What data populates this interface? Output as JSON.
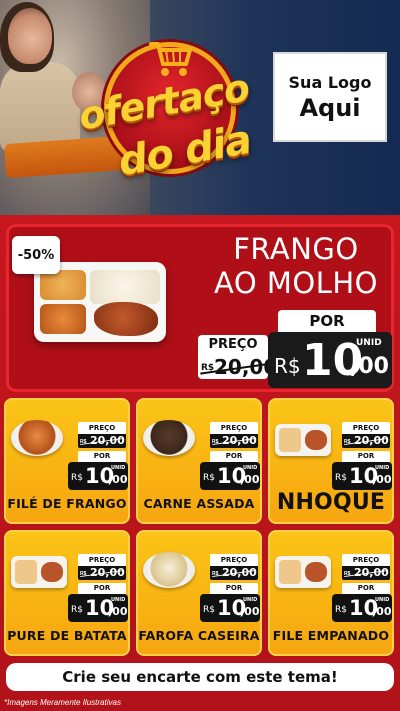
{
  "brand": {
    "badge_line1": "ofertaço",
    "badge_line2": "do dia",
    "colors": {
      "red": "#b3121a",
      "yellow": "#fbc417",
      "gold": "#fcd232",
      "dark": "#111111"
    }
  },
  "logo": {
    "line1": "Sua Logo",
    "line2": "Aqui"
  },
  "featured": {
    "discount": "-50%",
    "name_line1": "FRANGO",
    "name_line2": "AO MOLHO",
    "price_label": "PREÇO",
    "old_currency": "R$",
    "old_price": "20,00",
    "por_label": "POR",
    "new_currency": "R$",
    "new_main": "10",
    "new_cents": ",00",
    "unit": "UNID"
  },
  "products": [
    {
      "name": "FILÉ DE FRANGO",
      "price_label": "PREÇO",
      "old_currency": "R$",
      "old_price": "20,00",
      "por_label": "POR",
      "new_currency": "R$",
      "new_main": "10",
      "new_cents": ",00",
      "unit": "UNID"
    },
    {
      "name": "CARNE ASSADA",
      "price_label": "PREÇO",
      "old_currency": "R$",
      "old_price": "20,00",
      "por_label": "POR",
      "new_currency": "R$",
      "new_main": "10",
      "new_cents": ",00",
      "unit": "UNID"
    },
    {
      "name": "NHOQUE",
      "price_label": "PREÇO",
      "old_currency": "R$",
      "old_price": "20,00",
      "por_label": "POR",
      "new_currency": "R$",
      "new_main": "10",
      "new_cents": ",00",
      "unit": "UNID"
    },
    {
      "name": "PURE DE BATATA",
      "price_label": "PREÇO",
      "old_currency": "R$",
      "old_price": "20,00",
      "por_label": "POR",
      "new_currency": "R$",
      "new_main": "10",
      "new_cents": ",00",
      "unit": "UNID"
    },
    {
      "name": "FAROFA CASEIRA",
      "price_label": "PREÇO",
      "old_currency": "R$",
      "old_price": "20,00",
      "por_label": "POR",
      "new_currency": "R$",
      "new_main": "10",
      "new_cents": ",00",
      "unit": "UNID"
    },
    {
      "name": "FILE EMPANADO",
      "price_label": "PREÇO",
      "old_currency": "R$",
      "old_price": "20,00",
      "por_label": "POR",
      "new_currency": "R$",
      "new_main": "10",
      "new_cents": ",00",
      "unit": "UNID"
    }
  ],
  "cta": "Crie seu encarte com este tema!",
  "disclaimer": "*Imagens Meramente Ilustrativas"
}
